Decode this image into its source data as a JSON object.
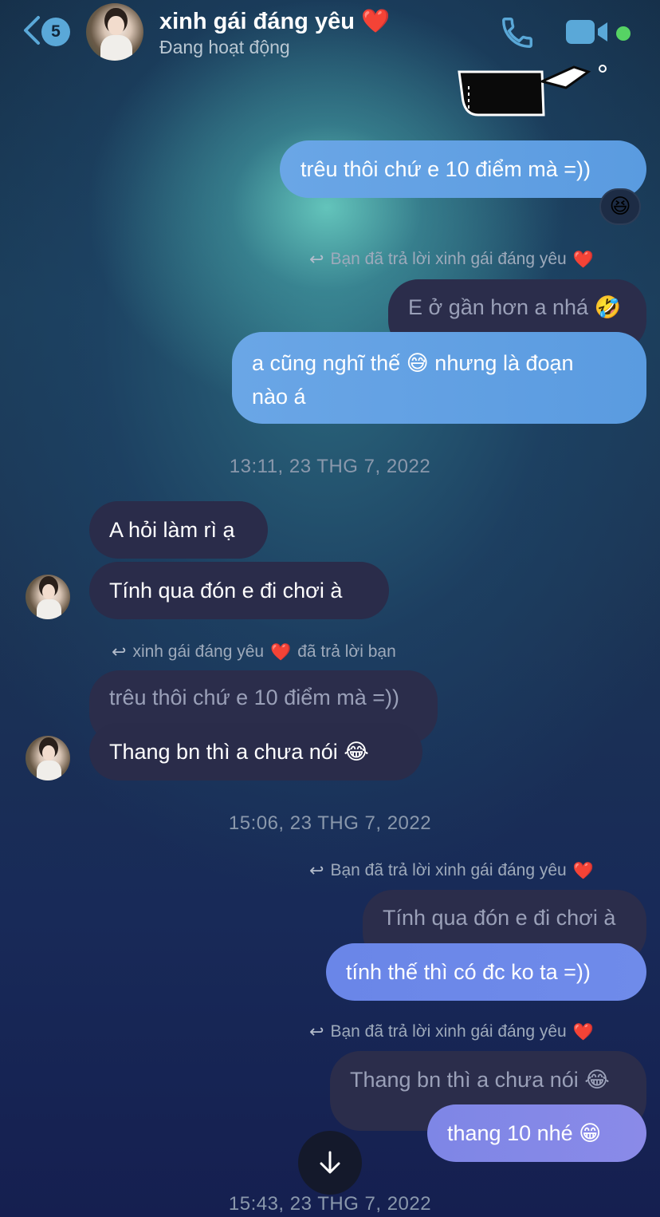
{
  "header": {
    "unread_count": "5",
    "contact_name": "xinh gái đáng yêu",
    "name_emoji": "❤️",
    "status": "Đang hoạt động"
  },
  "messages": {
    "m1_text": "trêu thôi chứ e 10 điểm mà =))",
    "m1_reaction": "😆",
    "reply1_note": "Bạn đã trả lời xinh gái đáng yêu",
    "reply1_heart": "❤️",
    "quote1": "E ở gần hơn a nhá 🤣",
    "m2_line1": "a cũng nghĩ thế 😅 nhưng là đoạn",
    "m2_line2": "nào á",
    "time1": "13:11, 23 THG 7, 2022",
    "in1": "A hỏi làm rì ạ",
    "in2": "Tính qua đón e đi chơi à",
    "reply2_note_a": "xinh gái đáng yêu",
    "reply2_heart": "❤️",
    "reply2_note_b": "đã trả lời bạn",
    "quote2": "trêu thôi chứ e 10 điểm mà =))",
    "in3": "Thang bn thì a chưa nói 😂",
    "time2": "15:06, 23 THG 7, 2022",
    "reply3_note": "Bạn đã trả lời xinh gái đáng yêu",
    "reply3_heart": "❤️",
    "quote3": "Tính qua đón e đi chơi à",
    "m3_text": "tính thế thì có đc ko ta =))",
    "reply4_note": "Bạn đã trả lời xinh gái đáng yêu",
    "reply4_heart": "❤️",
    "quote4": "Thang bn thì a chưa nói 😂",
    "m4_text": "thang 10 nhé 😁",
    "time3": "15:43, 23 THG 7, 2022"
  },
  "colors": {
    "accent": "#5aa8d8",
    "online": "#56d364",
    "incoming_bubble": "#2a2c4a",
    "outgoing_bubble": "#6aa6e6"
  },
  "icons": {
    "back": "chevron-left-icon",
    "call": "phone-icon",
    "video": "video-camera-icon",
    "reply": "reply-arrow-icon",
    "scroll": "arrow-down-icon"
  }
}
